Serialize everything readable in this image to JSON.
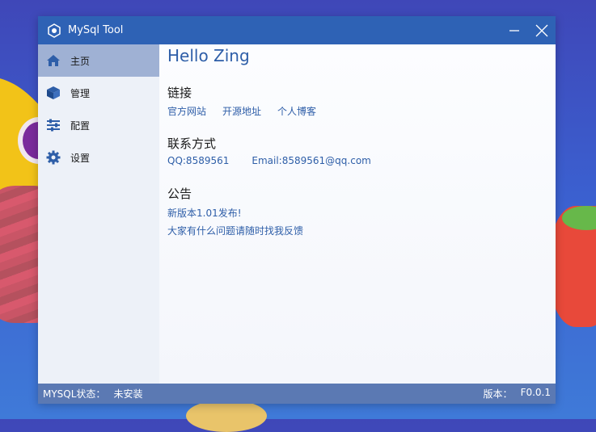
{
  "window": {
    "title": "MySql Tool",
    "minimize_icon": "minimize-icon",
    "close_icon": "close-icon"
  },
  "sidebar": {
    "items": [
      {
        "label": "主页",
        "icon": "home-icon",
        "active": true
      },
      {
        "label": "管理",
        "icon": "cube-icon",
        "active": false
      },
      {
        "label": "配置",
        "icon": "sliders-icon",
        "active": false
      },
      {
        "label": "设置",
        "icon": "gear-icon",
        "active": false
      }
    ]
  },
  "main": {
    "greeting": "Hello Zing",
    "links_section": {
      "title": "链接",
      "links": [
        "官方网站",
        "开源地址",
        "个人博客"
      ]
    },
    "contact_section": {
      "title": "联系方式",
      "qq": "QQ:8589561",
      "email": "Email:8589561@qq.com"
    },
    "notice_section": {
      "title": "公告",
      "lines": [
        "新版本1.01发布!",
        "大家有什么问题请随时找我反馈"
      ]
    }
  },
  "statusbar": {
    "mysql_label": "MYSQL状态：",
    "mysql_value": "未安装",
    "version_label": "版本：",
    "version_value": "F0.0.1"
  },
  "colors": {
    "titlebar": "#2e62b5",
    "accent": "#2e5ea8",
    "statusbar": "#5b79b3",
    "nav_active": "#9fb1d4"
  }
}
